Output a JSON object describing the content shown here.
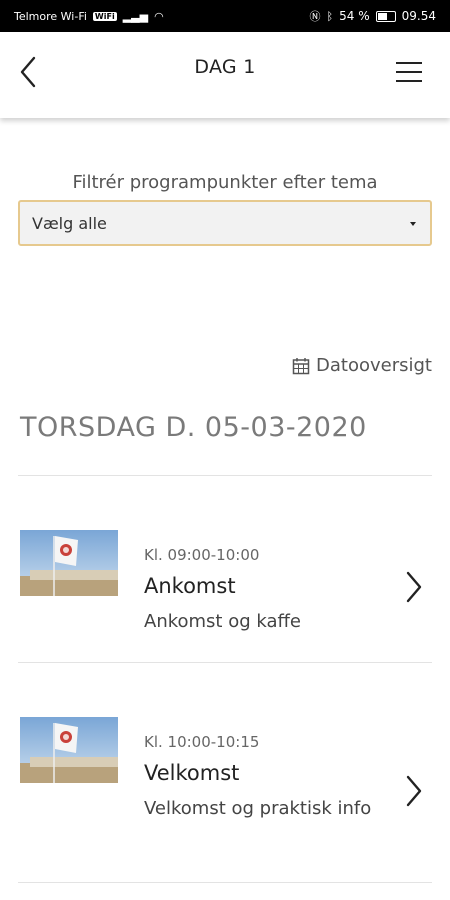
{
  "status_bar": {
    "carrier": "Telmore Wi-Fi",
    "wifi_badge": "WiFi",
    "battery": "54 %",
    "time": "09.54"
  },
  "header": {
    "title": "DAG 1"
  },
  "filter": {
    "label": "Filtrér programpunkter efter tema",
    "selected": "Vælg alle"
  },
  "date_overview": {
    "label": "Datooversigt",
    "icon": "calendar-icon"
  },
  "day_heading": "TORSDAG D. 05-03-2020",
  "items": [
    {
      "time": "Kl. 09:00-10:00",
      "title": "Ankomst",
      "description": "Ankomst og kaffe"
    },
    {
      "time": "Kl. 10:00-10:15",
      "title": "Velkomst",
      "description": "Velkomst og praktisk info"
    }
  ],
  "colors": {
    "filter_border": "#e6c98e",
    "heading_gray": "#7a7a7a"
  }
}
